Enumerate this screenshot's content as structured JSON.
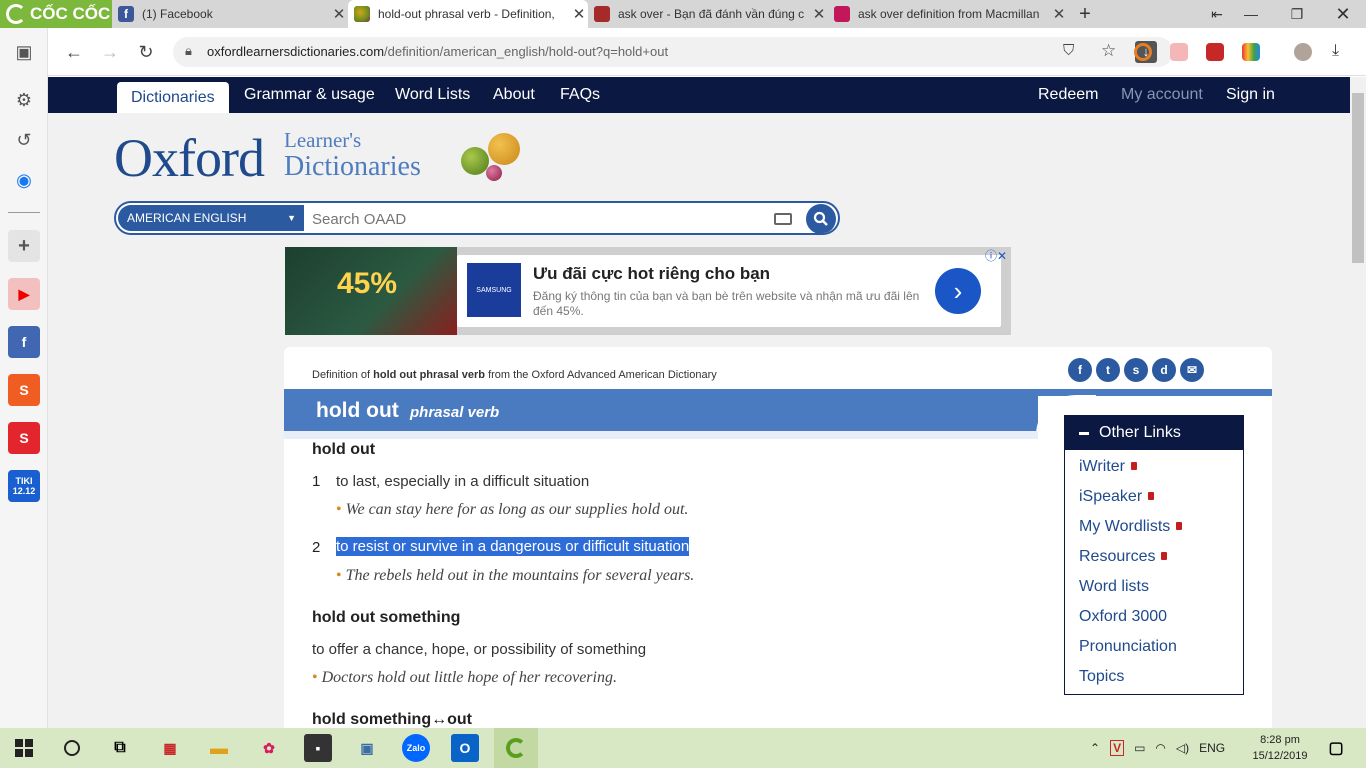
{
  "browser": {
    "brand": "CỐC CỐC",
    "tabs": [
      {
        "title": "(1) Facebook",
        "favicon": "facebook-icon"
      },
      {
        "title": "hold-out phrasal verb - Definition,",
        "favicon": "oxford-icon",
        "active": true
      },
      {
        "title": "ask over - Bạn đã đánh vần đúng c",
        "favicon": "cambridge-icon"
      },
      {
        "title": "ask over definition from Macmillan",
        "favicon": "macmillan-icon"
      }
    ],
    "url_domain": "oxfordlearnersdictionaries.com",
    "url_path": "/definition/american_english/hold-out?q=hold+out"
  },
  "site": {
    "nav": {
      "dictionaries": "Dictionaries",
      "grammar": "Grammar & usage",
      "wordlists": "Word Lists",
      "about": "About",
      "faqs": "FAQs",
      "redeem": "Redeem",
      "account": "My account",
      "signin": "Sign in"
    },
    "logo_main": "Oxford",
    "logo_sub1": "Learner's",
    "logo_sub2": "Dictionaries",
    "search": {
      "language": "AMERICAN ENGLISH",
      "placeholder": "Search OAAD"
    }
  },
  "ad": {
    "promo_pct": "45%",
    "logo": "SAMSUNG",
    "title": "Ưu đãi cực hot riêng cho bạn",
    "text": "Đăng ký thông tin của bạn và bạn bè trên website và nhận mã ưu đãi lên đến 45%."
  },
  "entry": {
    "crumb_prefix": "Definition of",
    "crumb_word": "hold out phrasal verb",
    "crumb_suffix": "from the Oxford Advanced American Dictionary",
    "headword": "hold out",
    "pos": "phrasal verb",
    "sense_groups": [
      {
        "phrase": "hold out",
        "senses": [
          {
            "num": "1",
            "def": "to last, especially in a difficult situation",
            "example": "We can stay here for as long as our supplies hold out."
          },
          {
            "num": "2",
            "def": "to resist or survive in a dangerous or difficult situation",
            "example": "The rebels held out in the mountains for several years.",
            "highlighted": true
          }
        ]
      },
      {
        "phrase": "hold out something",
        "def": "to offer a chance, hope, or possibility of something",
        "example": "Doctors hold out little hope of her recovering."
      },
      {
        "phrase": "hold something↔out"
      }
    ]
  },
  "other_links": {
    "title": "Other Links",
    "items": [
      {
        "label": "iWriter",
        "locked": true
      },
      {
        "label": "iSpeaker",
        "locked": true
      },
      {
        "label": "My Wordlists",
        "locked": true
      },
      {
        "label": "Resources",
        "locked": true
      },
      {
        "label": "Word lists",
        "locked": false
      },
      {
        "label": "Oxford 3000",
        "locked": false
      },
      {
        "label": "Pronunciation",
        "locked": false
      },
      {
        "label": "Topics",
        "locked": false
      }
    ]
  },
  "taskbar": {
    "lang": "ENG",
    "time": "8:28 pm",
    "date": "15/12/2019"
  },
  "colors": {
    "nav_bg": "#0b1942",
    "oxford_blue": "#1f4a8c",
    "headword_bar": "#4a7bc1",
    "highlight": "#2e6cd8",
    "coccoc_green": "#7cb83b"
  }
}
